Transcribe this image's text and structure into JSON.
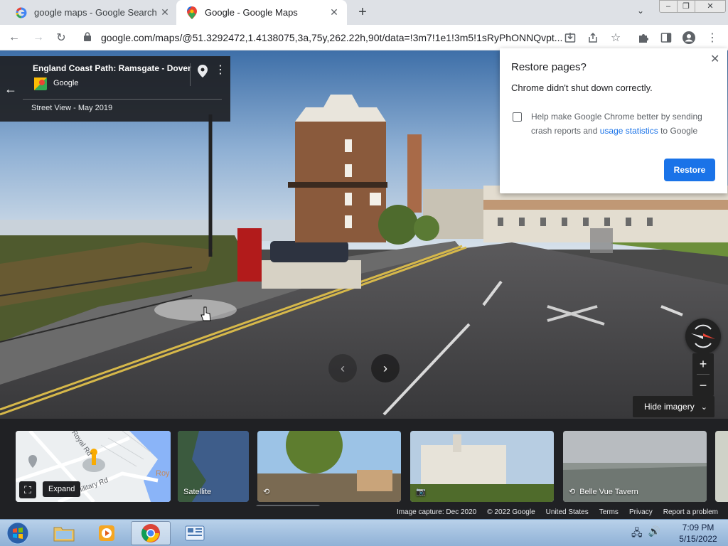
{
  "browser": {
    "tabs": [
      {
        "title": "google maps - Google Search",
        "icon": "google-g-icon"
      },
      {
        "title": "Google - Google Maps",
        "icon": "google-maps-icon"
      }
    ],
    "new_tab": "+",
    "address": "google.com/maps/@51.3292472,1.4138075,3a,75y,262.22h,90t/data=!3m7!1e1!3m5!1sRyPhONNQvpt..."
  },
  "infocard": {
    "title": "England Coast Path: Ramsgate - Dover",
    "provider": "Google",
    "date": "Street View - May 2019"
  },
  "controls": {
    "zoom_in": "+",
    "zoom_out": "−",
    "hide_imagery": "Hide imagery"
  },
  "restore_popup": {
    "title": "Restore pages?",
    "message": "Chrome didn't shut down correctly.",
    "checkbox_text_before": "Help make Google Chrome better by sending crash reports and ",
    "checkbox_link": "usage statistics",
    "checkbox_text_after": " to Google",
    "button": "Restore"
  },
  "filmstrip": {
    "map_roads": [
      "Royal Rd",
      "Military Rd",
      "Roy"
    ],
    "expand_tooltip": "Expand",
    "thumbnails": [
      {
        "label": "Satellite",
        "icon": ""
      },
      {
        "label": "",
        "icon": "360-icon"
      },
      {
        "label": "",
        "icon": "camera-icon"
      },
      {
        "label": "Belle Vue Tavern",
        "icon": "360-icon"
      }
    ]
  },
  "footer": {
    "links": [
      "Image capture: Dec 2020",
      "© 2022 Google",
      "United States",
      "Terms",
      "Privacy",
      "Report a problem"
    ]
  },
  "taskbar": {
    "time": "7:09 PM",
    "date": "5/15/2022"
  },
  "colors": {
    "accent": "#1a73e8",
    "dark_panel": "#202124",
    "taskbar": "#9fbcdd"
  }
}
